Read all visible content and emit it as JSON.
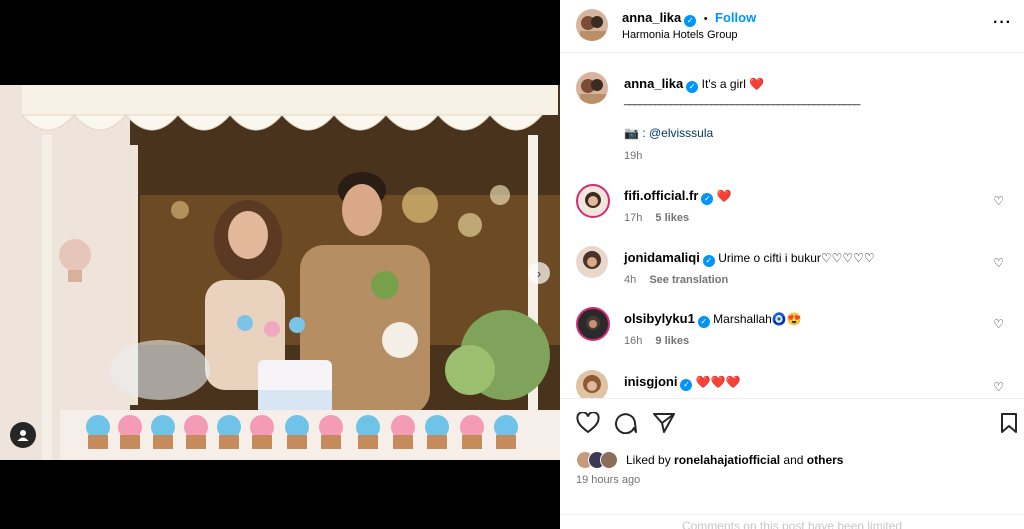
{
  "post": {
    "author": "anna_lika",
    "dot": "•",
    "follow_label": "Follow",
    "location": "Harmonia Hotels Group",
    "caption_text": "It's a girl",
    "caption_emoji": "❤️",
    "caption_divider": "______________________________________________",
    "caption_credit_emoji": "📷",
    "caption_credit": ": @elvisssula",
    "caption_time": "19h",
    "liked_prefix": "Liked by",
    "liked_user": "ronelahajatiofficial",
    "liked_and": "and",
    "liked_others": "others",
    "timestamp": "19 hours ago",
    "comments_limited": "Comments on this post have been limited"
  },
  "comments": [
    {
      "user": "fifi.official.fr",
      "text": "❤️",
      "time": "17h",
      "likes": "5 likes",
      "extra": ""
    },
    {
      "user": "jonidamaliqi",
      "text": "Urime o cifti i bukur♡♡♡♡♡",
      "time": "4h",
      "likes": "",
      "extra": "See translation"
    },
    {
      "user": "olsibylyku1",
      "text": "Marshallah🧿😍",
      "time": "16h",
      "likes": "9 likes",
      "extra": ""
    },
    {
      "user": "inisgjoni",
      "text": "❤️❤️❤️",
      "time": "",
      "likes": "",
      "extra": ""
    }
  ],
  "colors": {
    "accent": "#0095f6",
    "muted": "#737373",
    "heart": "#ed4956"
  },
  "icons": {
    "more": "more-icon",
    "like": "heart-icon",
    "comment": "comment-icon",
    "share": "share-icon",
    "save": "bookmark-icon",
    "tag": "user-tag-icon",
    "next": "chevron-right-icon"
  }
}
